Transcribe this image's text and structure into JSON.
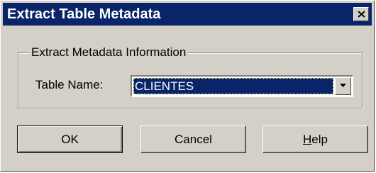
{
  "window": {
    "title": "Extract Table Metadata",
    "close_icon": "close-icon"
  },
  "group": {
    "legend": "Extract Metadata Information",
    "table_name_label": "Table Name:",
    "table_name_value": "CLIENTES",
    "dropdown_icon": "chevron-down-icon"
  },
  "buttons": {
    "ok_label": "OK",
    "cancel_label": "Cancel",
    "help_first": "H",
    "help_rest": "elp"
  },
  "colors": {
    "titlebar": "#0a246a",
    "face": "#d4d0c8",
    "selection": "#0a246a"
  }
}
